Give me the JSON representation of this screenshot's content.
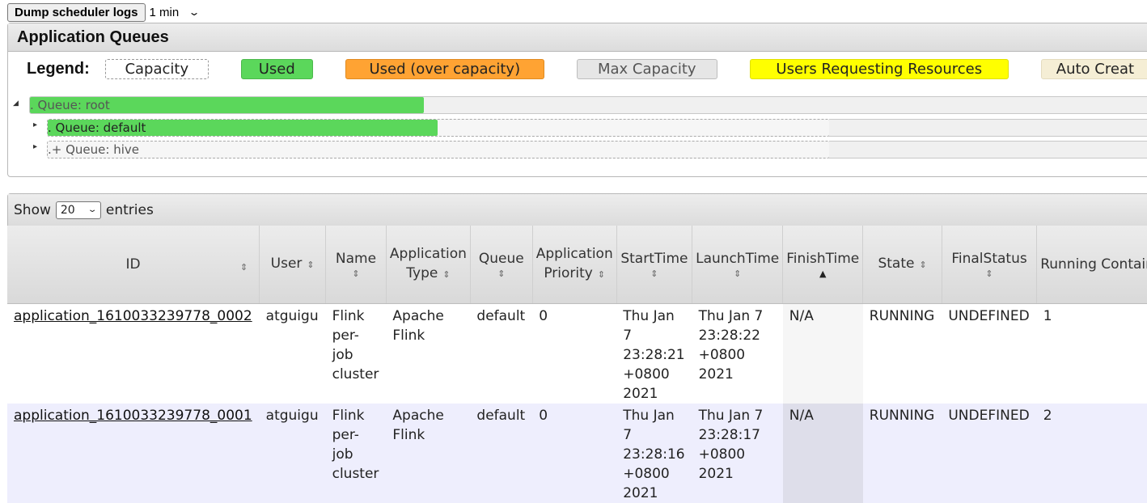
{
  "toolbar": {
    "dump_label": "Dump scheduler logs",
    "interval_value": "1 min"
  },
  "queues_panel": {
    "title": "Application Queues",
    "legend_title": "Legend:",
    "legend": {
      "capacity": "Capacity",
      "used": "Used",
      "over": "Used (over capacity)",
      "max": "Max Capacity",
      "users": "Users Requesting Resources",
      "auto": "Auto Creat"
    },
    "queues": [
      {
        "label": ".    Queue: root",
        "used_fraction": 0.34
      },
      {
        "label": ".    Queue: default",
        "used_fraction": 0.5
      },
      {
        "label": ".+ Queue: hive",
        "used_fraction": 0.0
      }
    ]
  },
  "apps_panel": {
    "show_label": "Show",
    "page_size": "20",
    "entries_label": "entries"
  },
  "table": {
    "headers": [
      "ID",
      "User",
      "Name",
      "Application Type",
      "Queue",
      "Application Priority",
      "StartTime",
      "LaunchTime",
      "FinishTime",
      "State",
      "FinalStatus",
      "Running Containers"
    ],
    "rows": [
      {
        "id": "application_1610033239778_0002",
        "user": "atguigu",
        "name": "Flink per-job cluster",
        "type": "Apache Flink",
        "queue": "default",
        "priority": "0",
        "start": "Thu Jan 7 23:28:21 +0800 2021",
        "launch": "Thu Jan 7 23:28:22 +0800 2021",
        "finish": "N/A",
        "state": "RUNNING",
        "final": "UNDEFINED",
        "containers": "1"
      },
      {
        "id": "application_1610033239778_0001",
        "user": "atguigu",
        "name": "Flink per-job cluster",
        "type": "Apache Flink",
        "queue": "default",
        "priority": "0",
        "start": "Thu Jan 7 23:28:16 +0800 2021",
        "launch": "Thu Jan 7 23:28:17 +0800 2021",
        "finish": "N/A",
        "state": "RUNNING",
        "final": "UNDEFINED",
        "containers": "2"
      }
    ]
  }
}
